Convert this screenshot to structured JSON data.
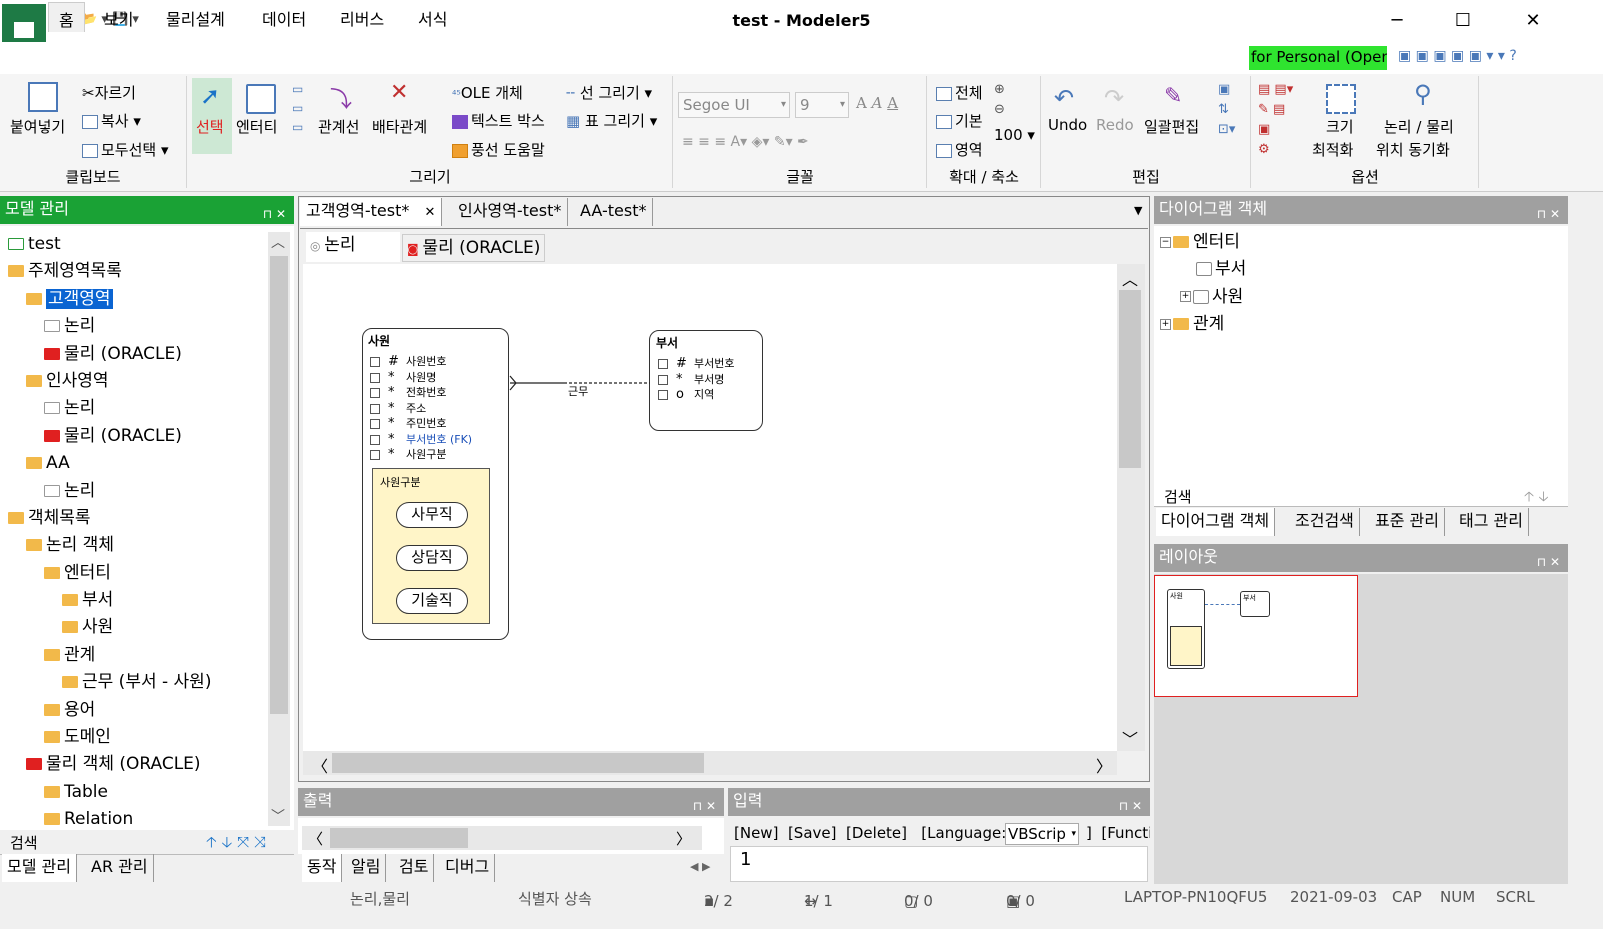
{
  "window": {
    "title": "test - Modeler5",
    "minimize": "─",
    "maximize": "☐",
    "close": "✕"
  },
  "menu": {
    "tabs": [
      "홈",
      "보기",
      "물리설계",
      "데이터",
      "리버스",
      "서식"
    ],
    "personal": "for Personal (Open)"
  },
  "ribbon": {
    "clipboard": {
      "paste": "붙여넣기",
      "cut": "자르기",
      "copy": "복사",
      "selectall": "모두선택",
      "group": "클립보드"
    },
    "draw": {
      "select": "선택",
      "entity": "엔터티",
      "relation": "관계선",
      "exclusive": "배타관계",
      "ole": "OLE 개체",
      "textbox": "텍스트 박스",
      "balloon": "풍선 도움말",
      "line": "선 그리기",
      "table": "표 그리기",
      "group": "그리기"
    },
    "font": {
      "name": "Segoe UI",
      "size": "9",
      "group": "글꼴"
    },
    "zoom": {
      "all": "전체",
      "default": "기본",
      "area": "영역",
      "value": "100",
      "group": "확대 / 축소"
    },
    "edit": {
      "undo": "Undo",
      "redo": "Redo",
      "batch": "일괄편집",
      "group": "편집"
    },
    "options": {
      "size": "크기",
      "optimize": "최적화",
      "logical": "논리 / 물리",
      "sync": "위치 동기화",
      "group": "옵션"
    }
  },
  "model_pane": {
    "title": "모델 관리",
    "search": "검색",
    "tabs": [
      "모델 관리",
      "AR 관리"
    ],
    "tree": [
      {
        "label": "test",
        "indent": 0
      },
      {
        "label": "주제영역목록",
        "indent": 0
      },
      {
        "label": "고객영역",
        "indent": 1
      },
      {
        "label": "논리",
        "indent": 2
      },
      {
        "label": "물리 (ORACLE)",
        "indent": 2
      },
      {
        "label": "인사영역",
        "indent": 1
      },
      {
        "label": "논리",
        "indent": 2
      },
      {
        "label": "물리 (ORACLE)",
        "indent": 2
      },
      {
        "label": "AA",
        "indent": 1
      },
      {
        "label": "논리",
        "indent": 2
      },
      {
        "label": "객체목록",
        "indent": 0
      },
      {
        "label": "논리 객체",
        "indent": 1
      },
      {
        "label": "엔터티",
        "indent": 2
      },
      {
        "label": "부서",
        "indent": 3
      },
      {
        "label": "사원",
        "indent": 3
      },
      {
        "label": "관계",
        "indent": 2
      },
      {
        "label": "근무 (부서 - 사원)",
        "indent": 3
      },
      {
        "label": "용어",
        "indent": 2
      },
      {
        "label": "도메인",
        "indent": 2
      },
      {
        "label": "물리 객체 (ORACLE)",
        "indent": 1
      },
      {
        "label": "Table",
        "indent": 2
      },
      {
        "label": "Relation",
        "indent": 2
      }
    ]
  },
  "doc_tabs": [
    "고객영역-test*",
    "인사영역-test*",
    "AA-test*"
  ],
  "view_tabs": [
    "논리",
    "물리 (ORACLE)"
  ],
  "diagram": {
    "employee": {
      "name": "사원",
      "attrs": [
        [
          "#",
          "사원번호"
        ],
        [
          "*",
          "사원명"
        ],
        [
          "*",
          "전화번호"
        ],
        [
          "*",
          "주소"
        ],
        [
          "*",
          "주민번호"
        ],
        [
          "*",
          "부서번호 (FK)"
        ],
        [
          "*",
          "사원구분"
        ]
      ],
      "subtype": {
        "name": "사원구분",
        "items": [
          "사무직",
          "상담직",
          "기술직"
        ]
      }
    },
    "dept": {
      "name": "부서",
      "attrs": [
        [
          "#",
          "부서번호"
        ],
        [
          "*",
          "부서명"
        ],
        [
          "o",
          "지역"
        ]
      ]
    },
    "relation_label": "근무"
  },
  "diag_obj_pane": {
    "title": "다이어그램 객체",
    "tree": [
      "엔터티",
      "부서",
      "사원",
      "관계"
    ],
    "search": "검색",
    "tabs": [
      "다이어그램 객체",
      "조건검색",
      "표준 관리",
      "태그 관리"
    ]
  },
  "layout_pane": {
    "title": "레이아웃",
    "mini_a": "사원",
    "mini_b": "부서"
  },
  "output_pane": {
    "title": "출력",
    "tabs": [
      "동작",
      "알림",
      "검토",
      "디버그"
    ]
  },
  "input_pane": {
    "title": "입력",
    "toolbar": "[New]  [Save]  [Delete]   [Language:",
    "lang": "VBScrip",
    "func": "]  [Functi",
    "line": "1"
  },
  "status": {
    "s1": "논리,물리",
    "s2": "식별자 상속",
    "s3": "2/   2",
    "s4": "1/   1",
    "s5": "0/   0",
    "s6": "0/   0",
    "host": "LAPTOP-PN10QFU5",
    "date": "2021-09-03",
    "cap": "CAP",
    "num": "NUM",
    "scrl": "SCRL"
  }
}
